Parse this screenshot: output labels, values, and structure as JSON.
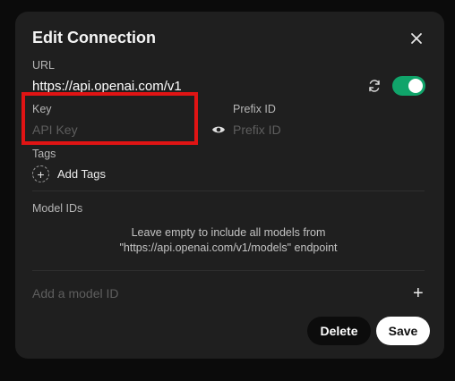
{
  "modal": {
    "title": "Edit Connection"
  },
  "url": {
    "label": "URL",
    "value": "https://api.openai.com/v1",
    "enabled": true
  },
  "key": {
    "label": "Key",
    "placeholder": "API Key"
  },
  "prefix": {
    "label": "Prefix ID",
    "placeholder": "Prefix ID"
  },
  "tags": {
    "label": "Tags",
    "add_label": "Add Tags"
  },
  "model_ids": {
    "label": "Model IDs",
    "helper_line1": "Leave empty to include all models from",
    "helper_line2": "\"https://api.openai.com/v1/models\" endpoint",
    "placeholder": "Add a model ID"
  },
  "actions": {
    "delete_label": "Delete",
    "save_label": "Save"
  },
  "colors": {
    "accent": "#10a46a",
    "highlight": "#e01414",
    "background": "#1f1f1f"
  },
  "icons": {
    "close": "close-icon",
    "refresh": "refresh-icon",
    "eye": "eye-icon",
    "plus": "plus-icon"
  }
}
